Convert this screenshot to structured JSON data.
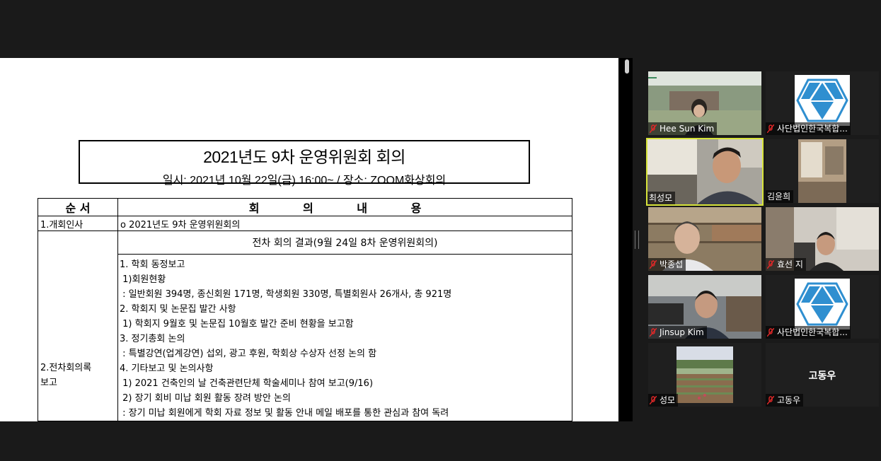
{
  "document": {
    "title": "2021년도 9차 운영위원회 회의",
    "subtitle": "일시: 2021년 10월 22일(금) 16:00~ / 장소: ZOOM화상회의",
    "table": {
      "header_order": "순 서",
      "header_content": "회 의 내 용",
      "row1_label": "1.개회인사",
      "row1_content": "o 2021년도 9차 운영위원회의",
      "row2_label": "2.전차회의록\n보고",
      "row2_heading": "전차 회의 결과(9월 24일 8차 운영위원회의)",
      "row2_lines": [
        "1. 학회 동정보고",
        " 1)회원현황",
        " : 일반회원 394명, 종신회원 171명, 학생회원 330명, 특별회원사 26개사, 총 921명",
        "2. 학회지 및 논문집 발간 사항",
        " 1) 학회지 9월호 및 논문집 10월호 발간 준비 현황을 보고함",
        "3. 정기총회 논의",
        " : 특별강연(업계강연) 섭외, 광고 후원, 학회상 수상자 선정 논의 함",
        "4. 기타보고 및 논의사항",
        " 1) 2021 건축인의 날 건축관련단체 학술세미나 참여 보고(9/16)",
        " 2) 장기 회비 미납 회원 활동 장려 방안 논의",
        " : 장기 미납 회원에게 학회 자료 정보 및 활동 안내 메일 배포를 통한 관심과 참여 독려"
      ]
    }
  },
  "participants": [
    {
      "name": "Hee Sun Kim",
      "muted": true,
      "video": "camera"
    },
    {
      "name": "사단법인한국복합...",
      "muted": true,
      "video": "logo"
    },
    {
      "name": "최성모",
      "muted": false,
      "video": "camera",
      "active_speaker": true
    },
    {
      "name": "김윤희",
      "muted": false,
      "video": "camera"
    },
    {
      "name": "박종섭",
      "muted": true,
      "video": "camera"
    },
    {
      "name": "효선 지",
      "muted": true,
      "video": "camera"
    },
    {
      "name": "Jinsup Kim",
      "muted": true,
      "video": "camera"
    },
    {
      "name": "사단법인한국복합...",
      "muted": true,
      "video": "logo"
    },
    {
      "name": "성모",
      "muted": true,
      "video": "picture"
    },
    {
      "name": "고동우",
      "muted": true,
      "video": "off",
      "center_name": "고동우"
    }
  ],
  "colors": {
    "active_speaker_border": "#d7e43a",
    "muted_icon": "#e02828",
    "logo_blue": "#2f8fd0"
  }
}
